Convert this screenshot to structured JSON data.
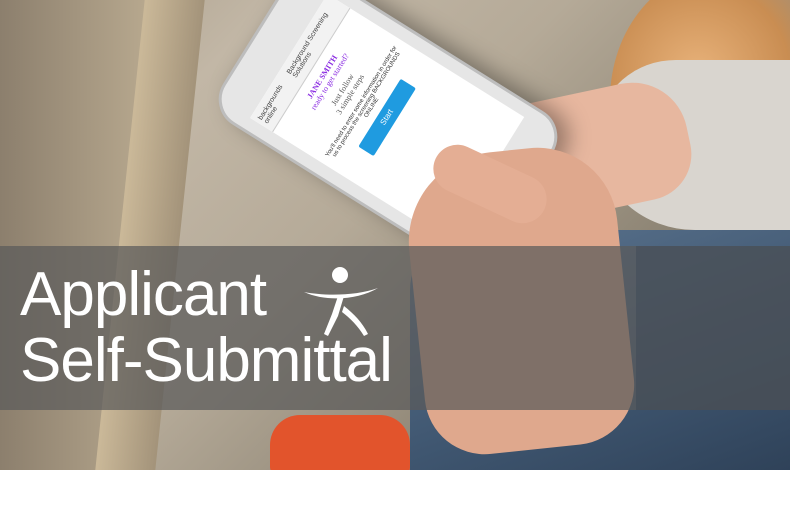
{
  "title": {
    "line1": "Applicant",
    "line2": "Self-Submittal"
  },
  "phone_screen": {
    "header": "backgrounds online",
    "header_tagline": "Background Screening Solutions",
    "name": "JANE SMITH",
    "ready": "ready to get started?",
    "follow": "Just follow",
    "steps": "3 simple steps",
    "body": "You'll need to enter some information in order for us to process the screening BACKGROUNDS ONLINE",
    "button": "Start"
  },
  "colors": {
    "band": "#5a5a5a",
    "title_text": "#ffffff",
    "accent_purple": "#8a2be2",
    "button_blue": "#1f9be0"
  },
  "icons": [
    "person-logo-icon"
  ]
}
